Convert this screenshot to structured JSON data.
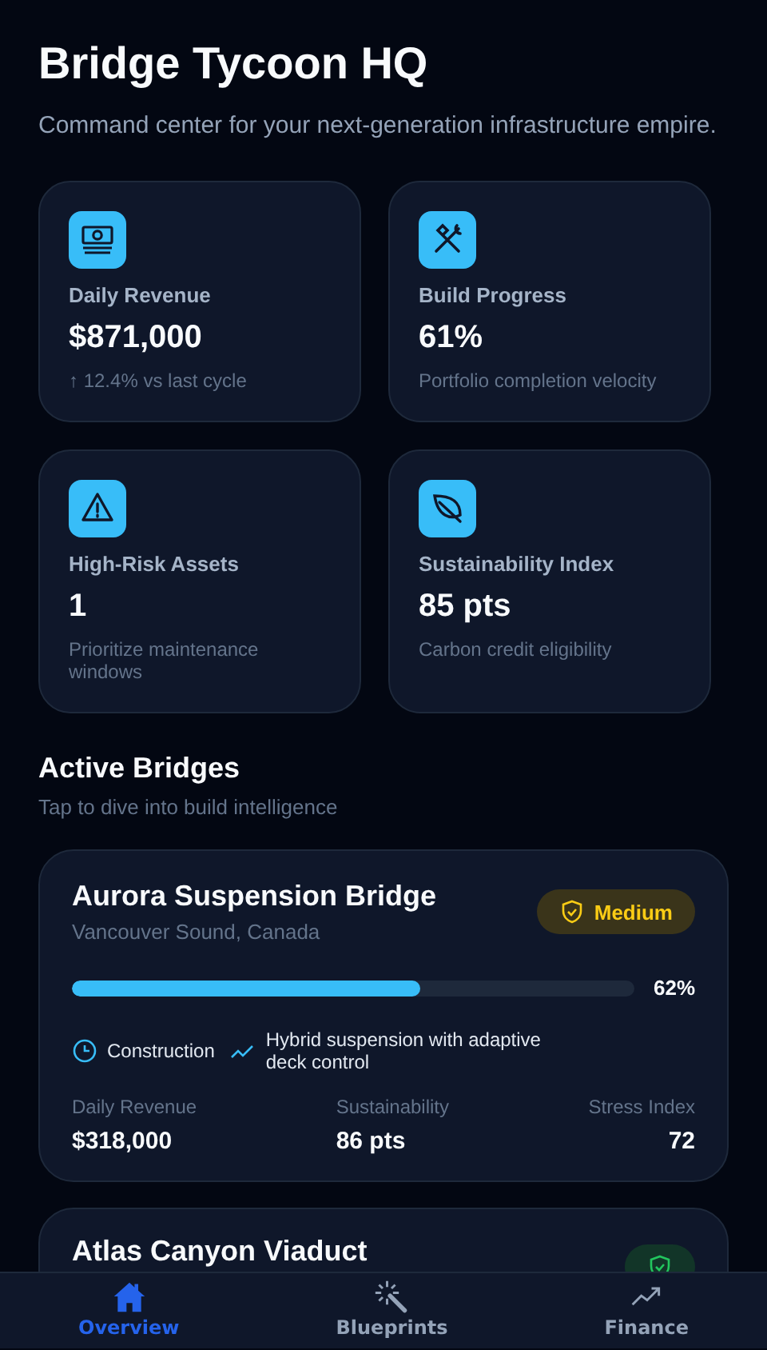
{
  "header": {
    "title": "Bridge Tycoon HQ",
    "subtitle": "Command center for your next-generation infrastructure empire."
  },
  "stats": [
    {
      "kind": "cash",
      "label": "Daily Revenue",
      "value": "$871,000",
      "note": "↑ 12.4% vs last cycle"
    },
    {
      "kind": "tools",
      "label": "Build Progress",
      "value": "61%",
      "note": "Portfolio completion velocity"
    },
    {
      "kind": "warning",
      "label": "High-Risk Assets",
      "value": "1",
      "note": "Prioritize maintenance windows"
    },
    {
      "kind": "leaf",
      "label": "Sustainability Index",
      "value": "85 pts",
      "note": "Carbon credit eligibility"
    }
  ],
  "section": {
    "title": "Active Bridges",
    "subtitle": "Tap to dive into build intelligence"
  },
  "bridges": [
    {
      "name": "Aurora Suspension Bridge",
      "location": "Vancouver Sound, Canada",
      "kind": "medium",
      "risk_label": "Medium",
      "level": 0.62,
      "progress": "62%",
      "phase": "Construction",
      "design": "Hybrid suspension with adaptive deck control",
      "metrics": [
        {
          "label": "Daily Revenue",
          "value": "$318,000"
        },
        {
          "label": "Sustainability",
          "value": "86 pts"
        },
        {
          "label": "Stress Index",
          "value": "72"
        }
      ]
    },
    {
      "name": "Atlas Canyon Viaduct",
      "kind": "low"
    }
  ],
  "nav": [
    {
      "kind": "home",
      "label": "Overview",
      "selected": true
    },
    {
      "kind": "wand",
      "label": "Blueprints",
      "selected": false
    },
    {
      "kind": "trend",
      "label": "Finance",
      "selected": false
    }
  ]
}
